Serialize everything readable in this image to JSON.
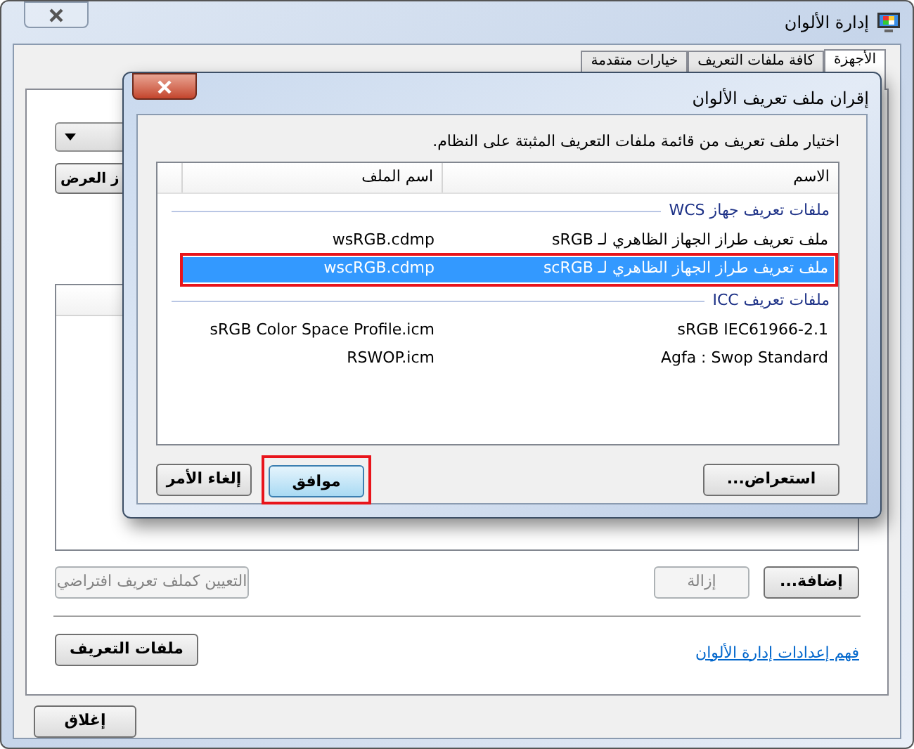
{
  "window": {
    "title": "إدارة الألوان"
  },
  "tabs": [
    {
      "label": "الأجهزة",
      "selected": true
    },
    {
      "label": "كافة ملفات التعريف",
      "selected": false
    },
    {
      "label": "خيارات متقدمة",
      "selected": false
    }
  ],
  "device_panel": {
    "partial_button": "ز العرض",
    "buttons": [
      {
        "label": "إضافة...",
        "disabled": false
      },
      {
        "label": "إزالة",
        "disabled": true
      },
      {
        "label": "التعيين كملف تعريف افتراضي",
        "disabled": true
      }
    ],
    "profiles_button": "ملفات التعريف",
    "link": "فهم إعدادات إدارة الألوان"
  },
  "close_button": "إغلاق",
  "dialog": {
    "title": "إقران ملف تعريف الألوان",
    "instruction": "اختيار ملف تعريف من قائمة ملفات التعريف المثبتة على النظام.",
    "columns": [
      "الاسم",
      "اسم الملف"
    ],
    "groups": [
      {
        "title": "ملفات تعريف جهاز WCS",
        "rows": [
          {
            "name": "ملف تعريف طراز الجهاز الظاهري لـ sRGB",
            "file": "wsRGB.cdmp",
            "selected": false,
            "outlined": false
          },
          {
            "name": "ملف تعريف طراز الجهاز الظاهري لـ scRGB",
            "file": "wscRGB.cdmp",
            "selected": true,
            "outlined": true
          }
        ]
      },
      {
        "title": "ملفات تعريف ICC",
        "rows": [
          {
            "name": "sRGB IEC61966-2.1",
            "file": "sRGB Color Space Profile.icm",
            "selected": false,
            "outlined": false
          },
          {
            "name": "Agfa : Swop Standard",
            "file": "RSWOP.icm",
            "selected": false,
            "outlined": false
          }
        ]
      }
    ],
    "buttons": [
      {
        "label": "استعراض...",
        "default": false,
        "outlined": false
      },
      {
        "label": "موافق",
        "default": true,
        "outlined": true
      },
      {
        "label": "إلغاء الأمر",
        "default": false,
        "outlined": false
      }
    ]
  }
}
